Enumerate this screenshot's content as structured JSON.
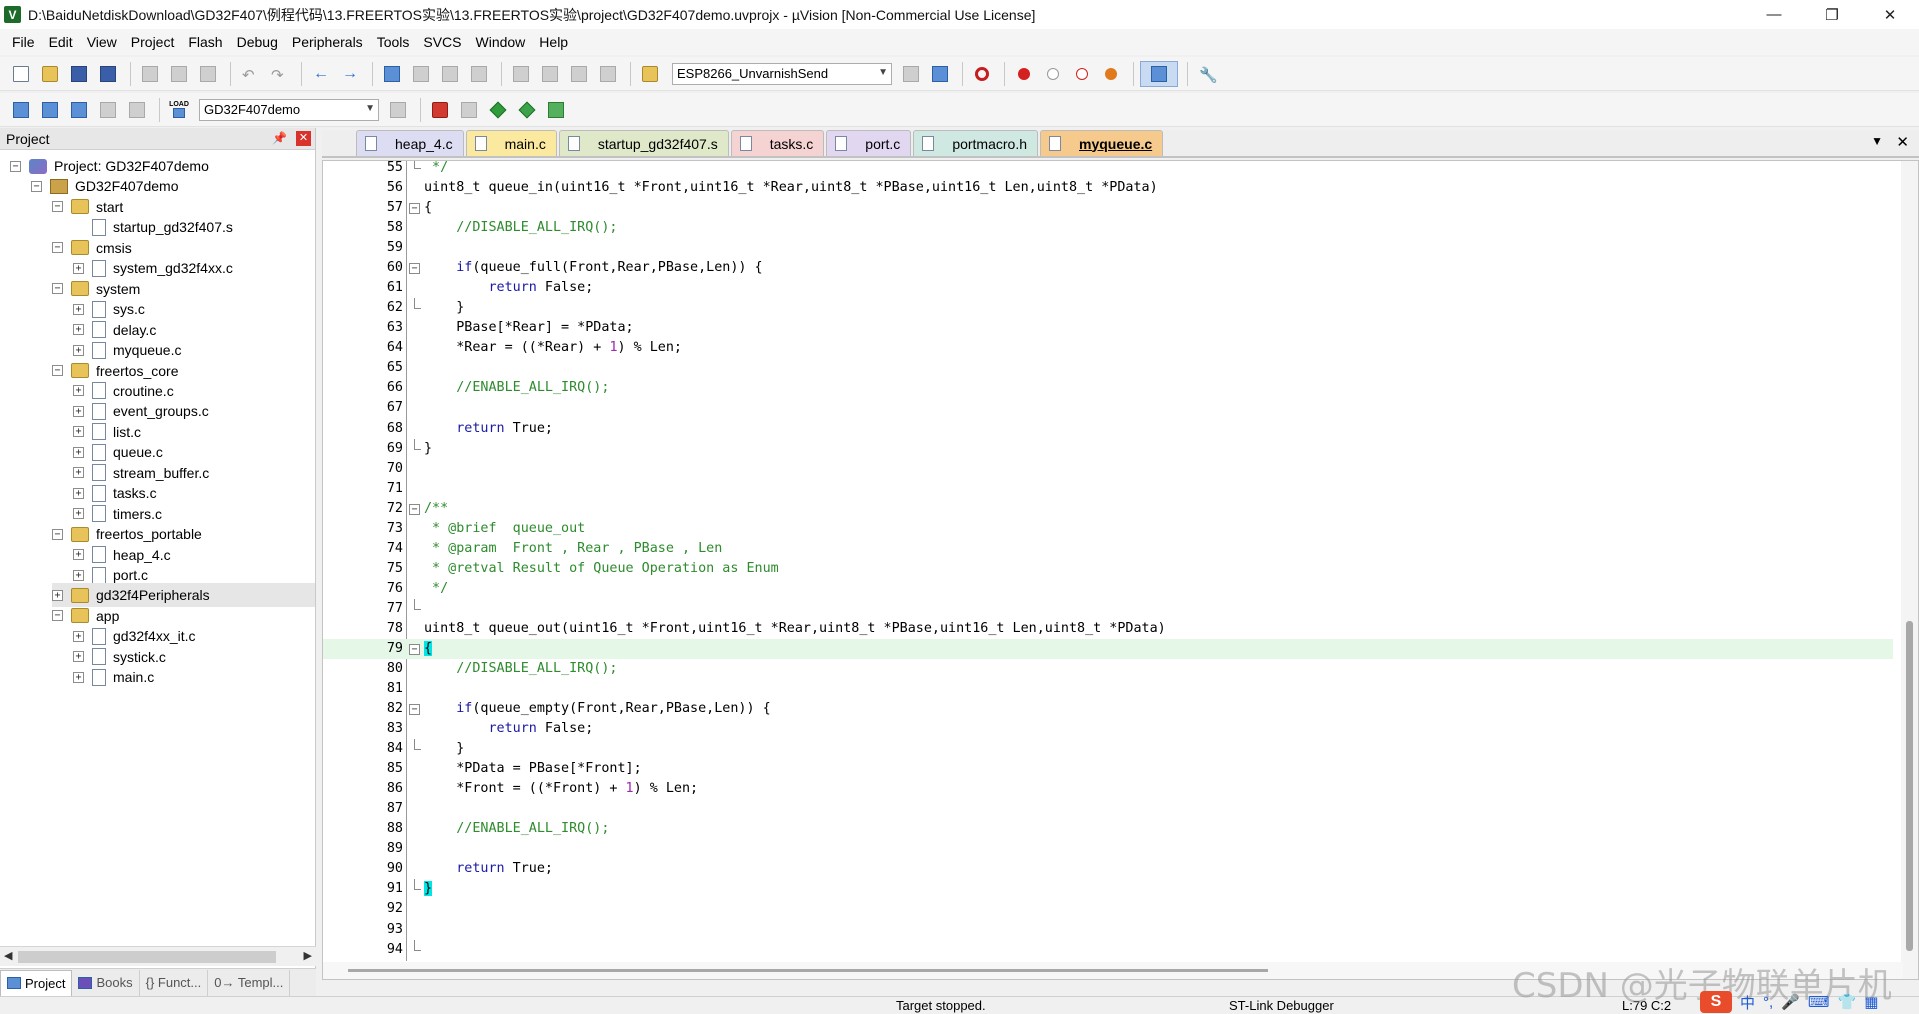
{
  "window": {
    "title": "D:\\BaiduNetdiskDownload\\GD32F407\\例程代码\\13.FREERTOS实验\\13.FREERTOS实验\\project\\GD32F407demo.uvprojx - µVision  [Non-Commercial Use License]",
    "app_icon": "V",
    "minimize_icon": "minimize-icon",
    "maximize_icon": "restore-icon",
    "close_icon": "close-icon"
  },
  "menu": [
    "File",
    "Edit",
    "View",
    "Project",
    "Flash",
    "Debug",
    "Peripherals",
    "Tools",
    "SVCS",
    "Window",
    "Help"
  ],
  "toolbar1": {
    "combo_value": "ESP8266_UnvarnishSend"
  },
  "toolbar2": {
    "load_label": "LOAD",
    "target_value": "GD32F407demo"
  },
  "project_panel": {
    "title": "Project",
    "tree": [
      {
        "label": "Project: GD32F407demo",
        "level": 0,
        "toggle": "−",
        "icon": "project"
      },
      {
        "label": "GD32F407demo",
        "level": 1,
        "toggle": "−",
        "icon": "target"
      },
      {
        "label": "start",
        "level": 2,
        "toggle": "−",
        "icon": "folder"
      },
      {
        "label": "startup_gd32f407.s",
        "level": 3,
        "toggle": "",
        "icon": "file"
      },
      {
        "label": "cmsis",
        "level": 2,
        "toggle": "−",
        "icon": "folder"
      },
      {
        "label": "system_gd32f4xx.c",
        "level": 3,
        "toggle": "+",
        "icon": "file"
      },
      {
        "label": "system",
        "level": 2,
        "toggle": "−",
        "icon": "folder"
      },
      {
        "label": "sys.c",
        "level": 3,
        "toggle": "+",
        "icon": "file"
      },
      {
        "label": "delay.c",
        "level": 3,
        "toggle": "+",
        "icon": "file"
      },
      {
        "label": "myqueue.c",
        "level": 3,
        "toggle": "+",
        "icon": "file"
      },
      {
        "label": "freertos_core",
        "level": 2,
        "toggle": "−",
        "icon": "folder"
      },
      {
        "label": "croutine.c",
        "level": 3,
        "toggle": "+",
        "icon": "file"
      },
      {
        "label": "event_groups.c",
        "level": 3,
        "toggle": "+",
        "icon": "file"
      },
      {
        "label": "list.c",
        "level": 3,
        "toggle": "+",
        "icon": "file"
      },
      {
        "label": "queue.c",
        "level": 3,
        "toggle": "+",
        "icon": "file"
      },
      {
        "label": "stream_buffer.c",
        "level": 3,
        "toggle": "+",
        "icon": "file"
      },
      {
        "label": "tasks.c",
        "level": 3,
        "toggle": "+",
        "icon": "file"
      },
      {
        "label": "timers.c",
        "level": 3,
        "toggle": "+",
        "icon": "file"
      },
      {
        "label": "freertos_portable",
        "level": 2,
        "toggle": "−",
        "icon": "folder"
      },
      {
        "label": "heap_4.c",
        "level": 3,
        "toggle": "+",
        "icon": "file"
      },
      {
        "label": "port.c",
        "level": 3,
        "toggle": "+",
        "icon": "file"
      },
      {
        "label": "gd32f4Peripherals",
        "level": 2,
        "toggle": "+",
        "icon": "folder",
        "selected": true
      },
      {
        "label": "app",
        "level": 2,
        "toggle": "−",
        "icon": "folder"
      },
      {
        "label": "gd32f4xx_it.c",
        "level": 3,
        "toggle": "+",
        "icon": "file"
      },
      {
        "label": "systick.c",
        "level": 3,
        "toggle": "+",
        "icon": "file"
      },
      {
        "label": "main.c",
        "level": 3,
        "toggle": "+",
        "icon": "file"
      }
    ],
    "bottom_tabs": [
      "Project",
      "Books",
      "{} Funct...",
      "0→ Templ..."
    ]
  },
  "editor_tabs": [
    {
      "label": "heap_4.c",
      "color": "#dcdcf2"
    },
    {
      "label": "main.c",
      "color": "#fbe9a0"
    },
    {
      "label": "startup_gd32f407.s",
      "color": "#dfe8c8"
    },
    {
      "label": "tasks.c",
      "color": "#f6d3d3"
    },
    {
      "label": "port.c",
      "color": "#e1d7f1"
    },
    {
      "label": "portmacro.h",
      "color": "#cfe8e1"
    },
    {
      "label": "myqueue.c",
      "color": "#f6c98d",
      "active": true
    }
  ],
  "code": [
    {
      "n": "55",
      "fold": "end",
      "segs": [
        [
          "cm",
          " */"
        ]
      ]
    },
    {
      "n": "56",
      "segs": [
        [
          "",
          "uint8_t queue_in(uint16_t *Front,uint16_t *Rear,uint8_t *PBase,uint16_t Len,uint8_t *PData)"
        ]
      ]
    },
    {
      "n": "57",
      "fold": "box",
      "segs": [
        [
          "",
          "{"
        ]
      ]
    },
    {
      "n": "58",
      "segs": [
        [
          "",
          "    "
        ],
        [
          "cm",
          "//DISABLE_ALL_IRQ();"
        ]
      ]
    },
    {
      "n": "59",
      "segs": [
        [
          "",
          ""
        ]
      ]
    },
    {
      "n": "60",
      "fold": "box",
      "segs": [
        [
          "",
          "    "
        ],
        [
          "kw",
          "if"
        ],
        [
          "",
          "(queue_full(Front,Rear,PBase,Len)) {"
        ]
      ]
    },
    {
      "n": "61",
      "segs": [
        [
          "",
          "        "
        ],
        [
          "kw",
          "return"
        ],
        [
          "",
          " False;"
        ]
      ]
    },
    {
      "n": "62",
      "fold": "end",
      "segs": [
        [
          "",
          "    }"
        ]
      ]
    },
    {
      "n": "63",
      "segs": [
        [
          "",
          "    PBase[*Rear] = *PData;"
        ]
      ]
    },
    {
      "n": "64",
      "segs": [
        [
          "",
          "    *Rear = ((*Rear) + "
        ],
        [
          "num",
          "1"
        ],
        [
          "",
          ") % Len;"
        ]
      ]
    },
    {
      "n": "65",
      "segs": [
        [
          "",
          ""
        ]
      ]
    },
    {
      "n": "66",
      "segs": [
        [
          "",
          "    "
        ],
        [
          "cm",
          "//ENABLE_ALL_IRQ();"
        ]
      ]
    },
    {
      "n": "67",
      "segs": [
        [
          "",
          ""
        ]
      ]
    },
    {
      "n": "68",
      "segs": [
        [
          "",
          "    "
        ],
        [
          "kw",
          "return"
        ],
        [
          "",
          " True;"
        ]
      ]
    },
    {
      "n": "69",
      "fold": "end",
      "segs": [
        [
          "",
          "}"
        ]
      ]
    },
    {
      "n": "70",
      "segs": [
        [
          "",
          ""
        ]
      ]
    },
    {
      "n": "71",
      "segs": [
        [
          "",
          ""
        ]
      ]
    },
    {
      "n": "72",
      "fold": "box",
      "segs": [
        [
          "cm",
          "/**"
        ]
      ]
    },
    {
      "n": "73",
      "segs": [
        [
          "cm",
          " * @brief  queue_out"
        ]
      ]
    },
    {
      "n": "74",
      "segs": [
        [
          "cm",
          " * @param  Front , Rear , PBase , Len"
        ]
      ]
    },
    {
      "n": "75",
      "segs": [
        [
          "cm",
          " * @retval Result of Queue Operation as Enum"
        ]
      ]
    },
    {
      "n": "76",
      "segs": [
        [
          "cm",
          " */"
        ]
      ]
    },
    {
      "n": "77",
      "fold": "end",
      "segs": [
        [
          "",
          ""
        ]
      ]
    },
    {
      "n": "78",
      "segs": [
        [
          "",
          "uint8_t queue_out(uint16_t *Front,uint16_t *Rear,uint8_t *PBase,uint16_t Len,uint8_t *PData)"
        ]
      ]
    },
    {
      "n": "79",
      "fold": "box",
      "current": true,
      "segs": [
        [
          "brace",
          "{"
        ]
      ]
    },
    {
      "n": "80",
      "segs": [
        [
          "",
          "    "
        ],
        [
          "cm",
          "//DISABLE_ALL_IRQ();"
        ]
      ]
    },
    {
      "n": "81",
      "segs": [
        [
          "",
          ""
        ]
      ]
    },
    {
      "n": "82",
      "fold": "box",
      "segs": [
        [
          "",
          "    "
        ],
        [
          "kw",
          "if"
        ],
        [
          "",
          "(queue_empty(Front,Rear,PBase,Len)) {"
        ]
      ]
    },
    {
      "n": "83",
      "segs": [
        [
          "",
          "        "
        ],
        [
          "kw",
          "return"
        ],
        [
          "",
          " False;"
        ]
      ]
    },
    {
      "n": "84",
      "fold": "end",
      "segs": [
        [
          "",
          "    }"
        ]
      ]
    },
    {
      "n": "85",
      "segs": [
        [
          "",
          "    *PData = PBase[*Front];"
        ]
      ]
    },
    {
      "n": "86",
      "segs": [
        [
          "",
          "    *Front = ((*Front) + "
        ],
        [
          "num",
          "1"
        ],
        [
          "",
          ") % Len;"
        ]
      ]
    },
    {
      "n": "87",
      "segs": [
        [
          "",
          ""
        ]
      ]
    },
    {
      "n": "88",
      "segs": [
        [
          "",
          "    "
        ],
        [
          "cm",
          "//ENABLE_ALL_IRQ();"
        ]
      ]
    },
    {
      "n": "89",
      "segs": [
        [
          "",
          ""
        ]
      ]
    },
    {
      "n": "90",
      "segs": [
        [
          "",
          "    "
        ],
        [
          "kw",
          "return"
        ],
        [
          "",
          " True;"
        ]
      ]
    },
    {
      "n": "91",
      "fold": "end",
      "segs": [
        [
          "brace",
          "}"
        ]
      ]
    },
    {
      "n": "92",
      "segs": [
        [
          "",
          ""
        ]
      ]
    },
    {
      "n": "93",
      "segs": [
        [
          "",
          ""
        ]
      ]
    },
    {
      "n": "94",
      "fold": "end",
      "segs": [
        [
          "",
          ""
        ]
      ]
    }
  ],
  "status": {
    "message": "Target stopped.",
    "debugger": "ST-Link Debugger",
    "position": "L:79 C:2"
  },
  "watermark": "CSDN @光子物联单片机",
  "ime": {
    "logo": "S",
    "items": [
      "中",
      "°,",
      "🎤",
      "⌨",
      "👕",
      "▦"
    ]
  }
}
